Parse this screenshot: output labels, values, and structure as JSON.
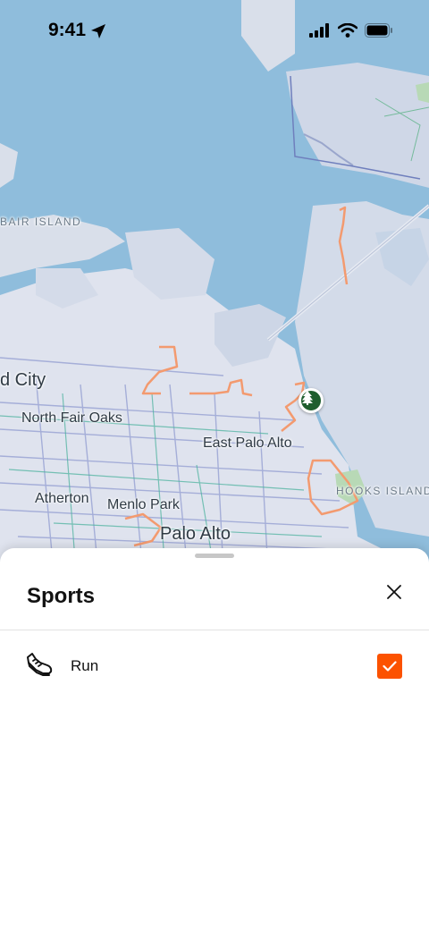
{
  "status_bar": {
    "time": "9:41"
  },
  "map": {
    "labels": {
      "bair_island": "BAIR ISLAND",
      "redwood_city": "d City",
      "north_fair_oaks": "North Fair Oaks",
      "east_palo_alto": "East Palo Alto",
      "hooks_island": "HOOKS ISLAND",
      "atherton": "Atherton",
      "menlo_park": "Menlo Park",
      "palo_alto": "Palo Alto"
    },
    "poi_icon": "tree-icon"
  },
  "sheet": {
    "title": "Sports",
    "close_icon": "close-icon",
    "items": [
      {
        "label": "Run",
        "icon": "shoe-icon",
        "checked": true
      }
    ]
  },
  "colors": {
    "accent": "#fc5200",
    "water": "#8fbddc",
    "land": "#dfe3ee",
    "route": "#f39a6f"
  }
}
